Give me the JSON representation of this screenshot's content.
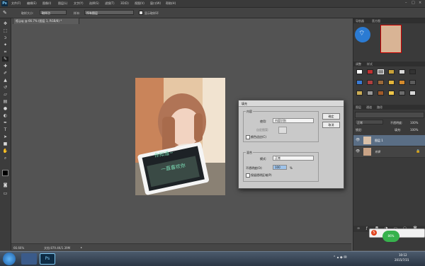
{
  "app": {
    "logo": "Ps"
  },
  "menu": [
    "文件(F)",
    "编辑(E)",
    "图像(I)",
    "图层(L)",
    "文字(Y)",
    "选择(S)",
    "滤镜(T)",
    "3D(D)",
    "视图(V)",
    "窗口(W)",
    "帮助(H)"
  ],
  "options": {
    "size_label": "取样大小:",
    "size_value": "取样点",
    "sample_label": "样本:",
    "sample_value": "所有图层",
    "show_ring": "显示取样环"
  },
  "document": {
    "tab_title": "相.jpg @ 66.7% (图层 1, RGB/8) *"
  },
  "status": {
    "zoom": "66.66%",
    "doc": "文档:879.4K/1.39M"
  },
  "panels": {
    "nav_tabs": [
      "导航器",
      "直方图"
    ],
    "swatch_tabs": [
      "调整",
      "样式"
    ],
    "layer_tabs": [
      "图层",
      "通道",
      "路径"
    ],
    "blend_mode": "正常",
    "opacity_label": "不透明度:",
    "opacity": "100%",
    "lock_label": "锁定:",
    "fill_label": "填充:",
    "fill": "100%",
    "layers": [
      {
        "name": "图层 1",
        "selected": true
      },
      {
        "name": "背景",
        "selected": false
      }
    ]
  },
  "photo": {
    "screen_text_1": "你知道~",
    "screen_text_2": "一直喜欢你"
  },
  "dialog": {
    "title": "填充",
    "content_group": "内容",
    "use_label": "使用:",
    "use_value": "内容识别",
    "custom_pattern_label": "自定图案:",
    "color_adapt_label": "颜色适应(C)",
    "blend_group": "混合",
    "mode_label": "模式:",
    "mode_value": "正常",
    "opacity_label": "不透明度(O):",
    "opacity_value": "100",
    "opacity_unit": "%",
    "preserve_label": "保留透明区域(P)",
    "ok": "确定",
    "cancel": "取消"
  },
  "taskbar": {
    "time": "10:12",
    "date": "2015/7/31",
    "speed": "86%"
  }
}
